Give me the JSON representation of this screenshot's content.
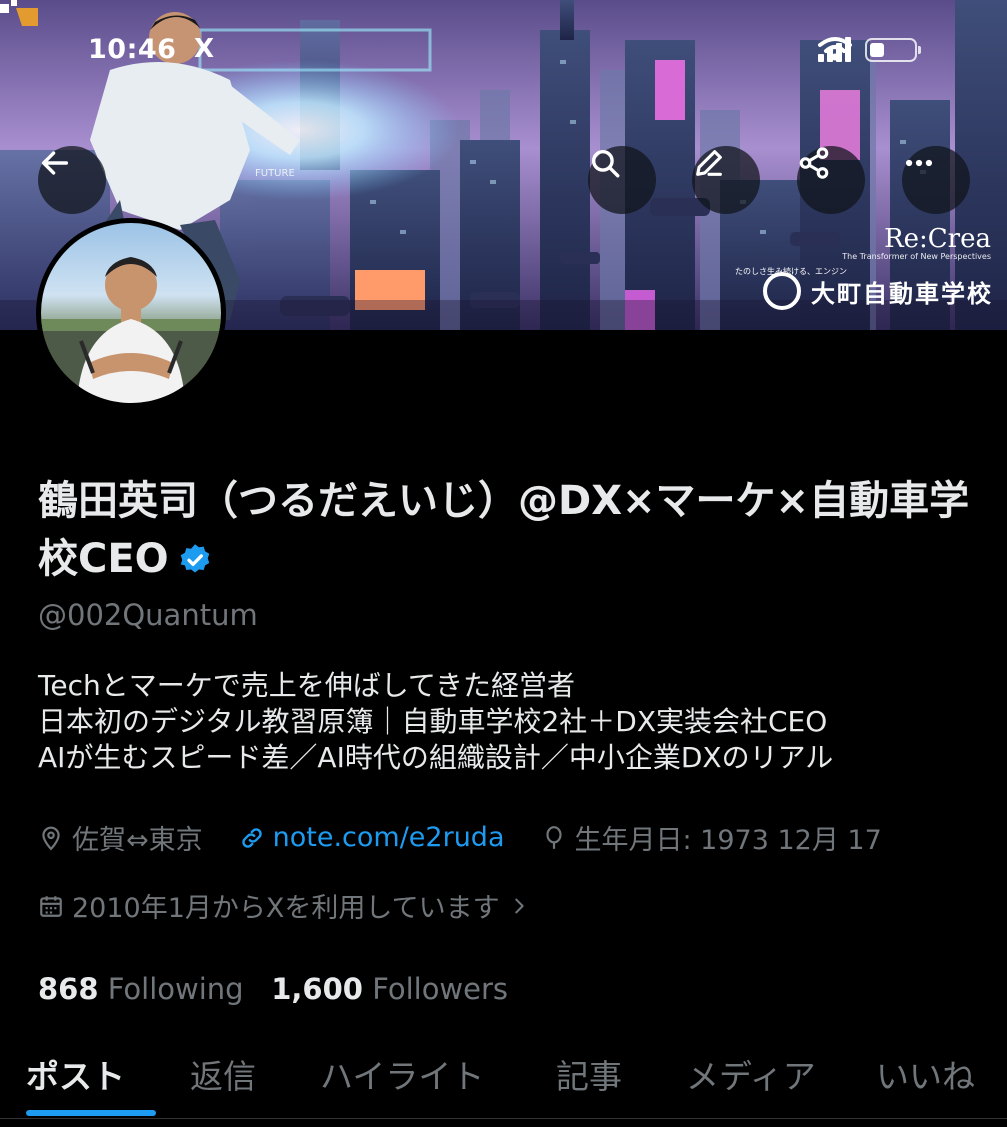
{
  "status_bar": {
    "time": "10:46",
    "app_mark": "X"
  },
  "banner": {
    "logo_recrea": "Re:Crea",
    "logo_recrea_tagline": "The Transformer of New Perspectives",
    "logo_omachi_tagline": "たのしさ生み続ける、エンジン",
    "logo_omachi": "大町自動車学校",
    "future_text": "FUTURE"
  },
  "header_actions": {
    "back_icon": "arrow-left-icon",
    "search_icon": "search-icon",
    "edit_icon": "pencil-icon",
    "share_icon": "share-icon",
    "more_icon": "more-icon"
  },
  "profile": {
    "name": "鶴田英司（つるだえいじ）@DX×マーケ×自動車学校CEO",
    "handle": "@002Quantum",
    "bio": [
      "Techとマーケで売上を伸ばしてきた経営者",
      "日本初のデジタル教習原簿｜自動車学校2社＋DX実装会社CEO",
      "AIが生むスピード差／AI時代の組織設計／中小企業DXのリアル"
    ],
    "location": "佐賀⇔東京",
    "link": "note.com/e2ruda",
    "birthday": "生年月日: 1973 12月 17",
    "joined": "2010年1月からXを利用しています",
    "following_count": "868",
    "following_label": "Following",
    "followers_count": "1,600",
    "followers_label": "Followers"
  },
  "tabs": [
    {
      "label": "ポスト",
      "active": true
    },
    {
      "label": "返信"
    },
    {
      "label": "ハイライト"
    },
    {
      "label": "記事"
    },
    {
      "label": "メディア"
    },
    {
      "label": "いいね"
    }
  ],
  "colors": {
    "accent": "#1d9bf0",
    "muted": "#71767b",
    "text": "#e7e9ea",
    "background": "#000000"
  }
}
